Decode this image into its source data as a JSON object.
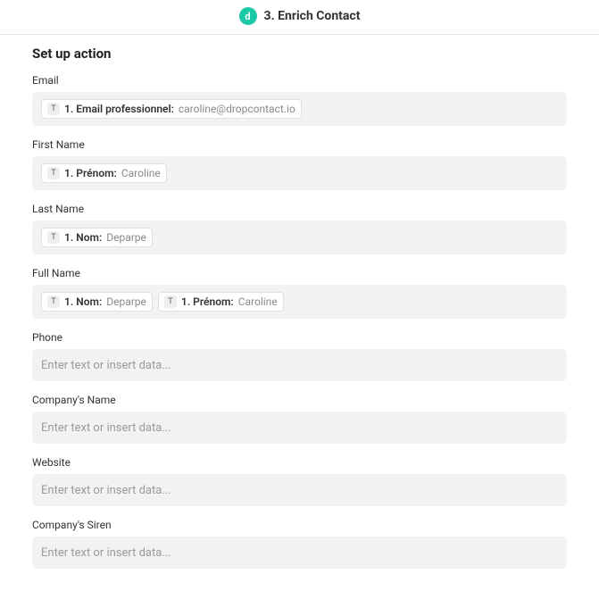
{
  "header": {
    "icon_text": "d",
    "title": "3. Enrich Contact"
  },
  "section_title": "Set up action",
  "placeholder": "Enter text or insert data...",
  "fields": {
    "email": {
      "label": "Email",
      "pills": [
        {
          "label": "1. Email professionnel:",
          "value": "caroline@dropcontact.io"
        }
      ]
    },
    "first_name": {
      "label": "First Name",
      "pills": [
        {
          "label": "1. Prénom:",
          "value": "Caroline"
        }
      ]
    },
    "last_name": {
      "label": "Last Name",
      "pills": [
        {
          "label": "1. Nom:",
          "value": "Deparpe"
        }
      ]
    },
    "full_name": {
      "label": "Full Name",
      "pills": [
        {
          "label": "1. Nom:",
          "value": "Deparpe"
        },
        {
          "label": "1. Prénom:",
          "value": "Caroline"
        }
      ]
    },
    "phone": {
      "label": "Phone",
      "pills": []
    },
    "company_name": {
      "label": "Company's Name",
      "pills": []
    },
    "website": {
      "label": "Website",
      "pills": []
    },
    "company_siren": {
      "label": "Company's Siren",
      "pills": []
    }
  }
}
